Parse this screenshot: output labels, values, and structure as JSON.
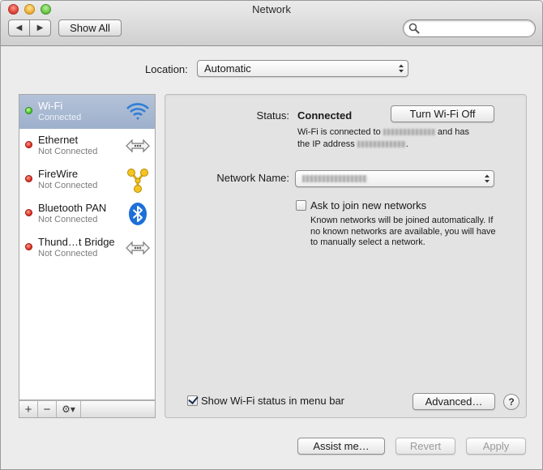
{
  "window": {
    "title": "Network"
  },
  "toolbar": {
    "back_glyph": "◀",
    "forward_glyph": "▶",
    "show_all": "Show All",
    "search_placeholder": ""
  },
  "location": {
    "label": "Location:",
    "value": "Automatic"
  },
  "services": [
    {
      "name": "Wi-Fi",
      "status": "Connected",
      "state": "green",
      "icon": "wifi-icon",
      "selected": true
    },
    {
      "name": "Ethernet",
      "status": "Not Connected",
      "state": "red",
      "icon": "ethernet-icon",
      "selected": false
    },
    {
      "name": "FireWire",
      "status": "Not Connected",
      "state": "red",
      "icon": "firewire-icon",
      "selected": false
    },
    {
      "name": "Bluetooth PAN",
      "status": "Not Connected",
      "state": "red",
      "icon": "bluetooth-icon",
      "selected": false
    },
    {
      "name": "Thund…t Bridge",
      "status": "Not Connected",
      "state": "red",
      "icon": "thunderbolt-bridge-icon",
      "selected": false
    }
  ],
  "sidebar_bar": {
    "add": "+",
    "remove": "−",
    "gear": "⚙▾"
  },
  "detail": {
    "status_label": "Status:",
    "status_value": "Connected",
    "turn_off_button": "Turn Wi-Fi Off",
    "info_line1_prefix": "Wi-Fi is connected to",
    "info_line1_suffix": "and has",
    "info_line2_prefix": "the IP address",
    "info_line2_suffix": ".",
    "network_name_label": "Network Name:",
    "ask_to_join_label": "Ask to join new networks",
    "ask_to_join_checked": false,
    "ask_help": "Known networks will be joined automatically. If no known networks are available, you will have to manually select a network.",
    "show_status_label": "Show Wi-Fi status in menu bar",
    "show_status_checked": true,
    "advanced_button": "Advanced…",
    "help_button": "?"
  },
  "footer": {
    "assist_button": "Assist me…",
    "revert_button": "Revert",
    "apply_button": "Apply"
  },
  "colors": {
    "selection": "#a8b8d2",
    "connected": "#3fbf22",
    "not_connected": "#d8241a",
    "wifi_blue": "#2f7fd6",
    "bluetooth_blue": "#1c6fd8",
    "firewire_yellow": "#f0c419"
  }
}
